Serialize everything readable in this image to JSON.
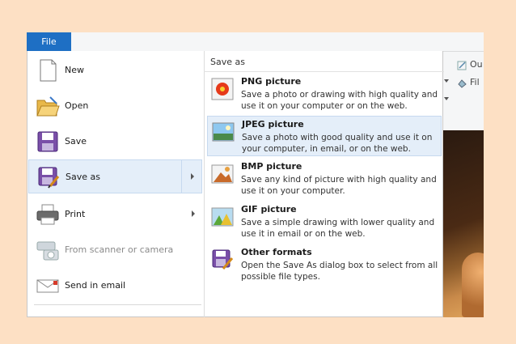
{
  "file_tab": "File",
  "ribbon": {
    "outline_label": "Ou",
    "fill_label": "Fil"
  },
  "menu": {
    "commands": [
      {
        "label": "New"
      },
      {
        "label": "Open"
      },
      {
        "label": "Save"
      },
      {
        "label": "Save as"
      },
      {
        "label": "Print"
      },
      {
        "label": "From scanner or camera"
      },
      {
        "label": "Send in email"
      }
    ],
    "save_as": {
      "heading": "Save as",
      "items": [
        {
          "title": "PNG picture",
          "desc": "Save a photo or drawing with high quality and use it on your computer or on the web."
        },
        {
          "title": "JPEG picture",
          "desc": "Save a photo with good quality and use it on your computer, in email, or on the web."
        },
        {
          "title": "BMP picture",
          "desc": "Save any kind of picture with high quality and use it on your computer."
        },
        {
          "title": "GIF picture",
          "desc": "Save a simple drawing with lower quality and use it in email or on the web."
        },
        {
          "title": "Other formats",
          "desc": "Open the Save As dialog box to select from all possible file types."
        }
      ]
    }
  }
}
